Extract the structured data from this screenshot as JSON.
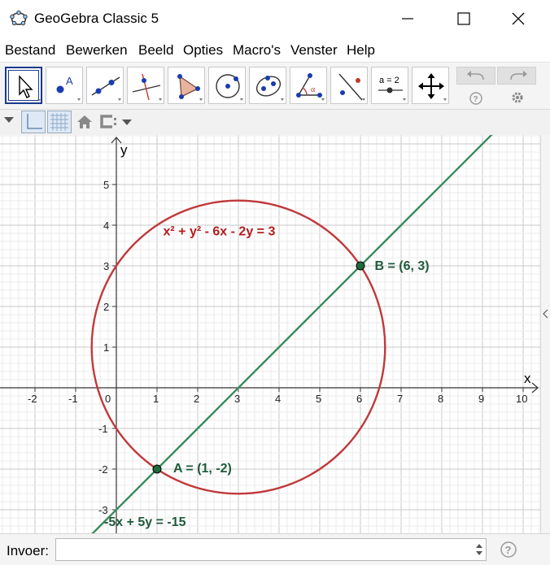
{
  "window": {
    "title": "GeoGebra Classic 5"
  },
  "menu": [
    "Bestand",
    "Bewerken",
    "Beeld",
    "Opties",
    "Macro's",
    "Venster",
    "Help"
  ],
  "toolbar": {
    "tools": [
      "move-tool",
      "point-tool",
      "line-tool",
      "perpendicular-line-tool",
      "polygon-tool",
      "circle-center-point-tool",
      "conic-tool",
      "angle-tool",
      "reflect-tool",
      "slider-tool",
      "move-graphics-view-tool"
    ],
    "slider_tool_text": "a = 2"
  },
  "graphics": {
    "axes": {
      "x_label": "x",
      "y_label": "y"
    },
    "x_ticks": [
      -2,
      -1,
      0,
      1,
      2,
      3,
      4,
      5,
      6,
      7,
      8,
      9,
      10
    ],
    "y_ticks": [
      -3,
      -2,
      -1,
      1,
      2,
      3,
      4,
      5
    ],
    "objects": {
      "circle": {
        "equation": "x² + y² - 6x - 2y = 3",
        "center": [
          3,
          1
        ],
        "radius": 3.606,
        "color": "#c0393b"
      },
      "line": {
        "equation": "-5x + 5y = -15",
        "color": "#3d8a5f"
      },
      "point_A": {
        "label": "A = (1, -2)",
        "x": 1,
        "y": -2
      },
      "point_B": {
        "label": "B = (6, 3)",
        "x": 6,
        "y": 3
      }
    },
    "colors": {
      "label_green": "#1f5a3a",
      "label_red": "#b51d1f",
      "point_fill": "#1d6b3a"
    }
  },
  "inputbar": {
    "label": "Invoer:",
    "value": ""
  }
}
